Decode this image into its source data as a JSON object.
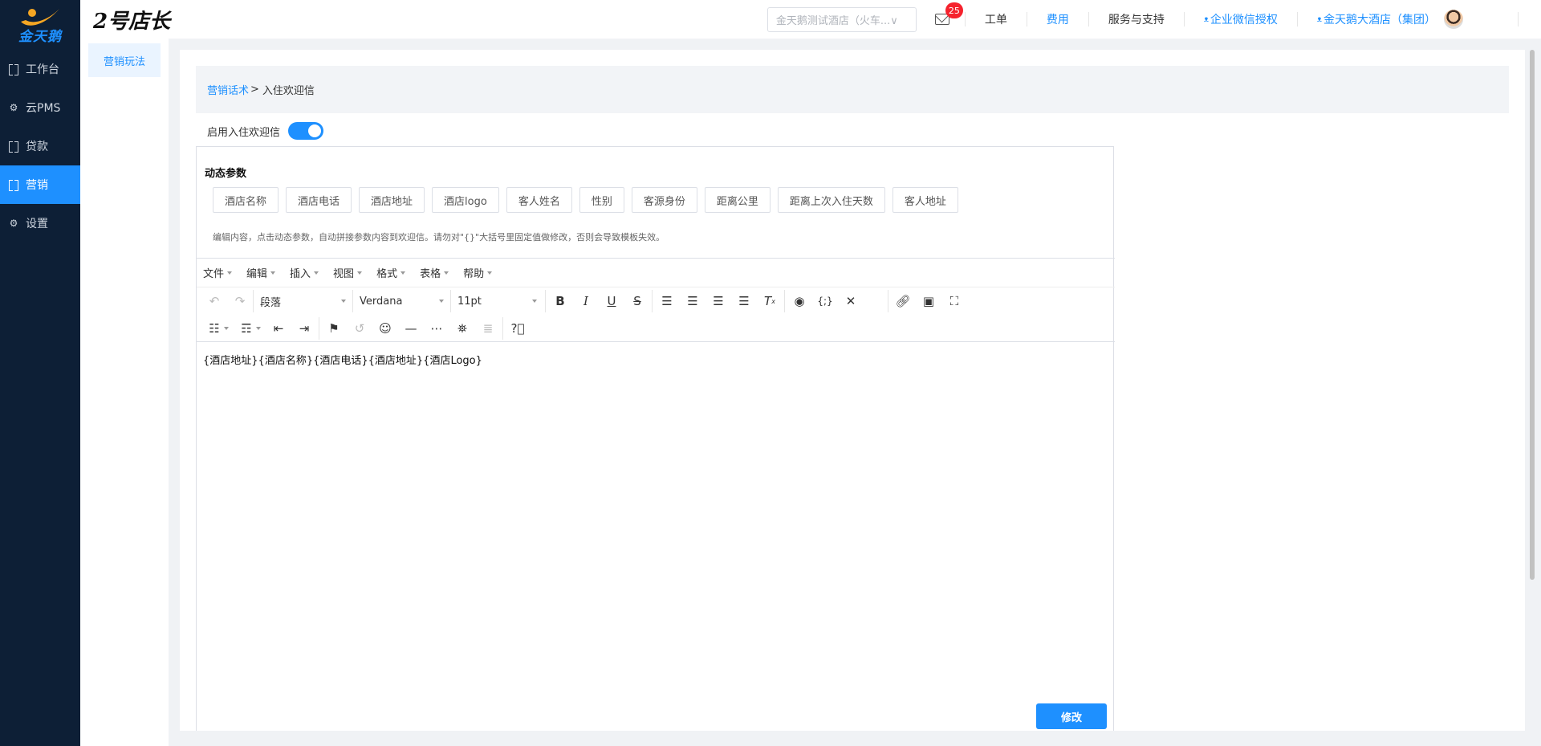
{
  "brand": {
    "logo_text": "金天鹅",
    "app_title": "2号店长"
  },
  "colors": {
    "sidebar_bg": "#0d1f36",
    "accent": "#1e90ff",
    "badge": "#f5222d"
  },
  "sidebar": {
    "items": [
      {
        "label": "工作台",
        "icon": "bracket-icon",
        "active": false
      },
      {
        "label": "云PMS",
        "icon": "gear-icon",
        "active": false
      },
      {
        "label": "贷款",
        "icon": "bracket-icon",
        "active": false
      },
      {
        "label": "营销",
        "icon": "bracket-icon",
        "active": true
      },
      {
        "label": "设置",
        "icon": "gear-icon",
        "active": false
      }
    ]
  },
  "header": {
    "store_select": "金天鹅测试酒店（火车...∨",
    "mail_badge": "25",
    "links": [
      "工单",
      "费用",
      "服务与支持",
      "企业微信授权",
      "金天鹅大酒店（集团）"
    ]
  },
  "submenu": {
    "item": "营销玩法"
  },
  "breadcrumb": {
    "link": "营销话术",
    "sep": ">",
    "current": "入住欢迎信"
  },
  "toggle": {
    "label": "启用入住欢迎信",
    "enabled": true
  },
  "params": {
    "title": "动态参数",
    "buttons": [
      "酒店名称",
      "酒店电话",
      "酒店地址",
      "酒店logo",
      "客人姓名",
      "性别",
      "客源身份",
      "距离公里",
      "距离上次入住天数",
      "客人地址"
    ],
    "hint": "编辑内容，点击动态参数，自动拼接参数内容到欢迎信。请勿对\"{}\"大括号里固定值做修改，否则会导致模板失效。"
  },
  "editor": {
    "menus": [
      "文件",
      "编辑",
      "插入",
      "视图",
      "格式",
      "表格",
      "帮助"
    ],
    "block_format": "段落",
    "font_family": "Verdana",
    "font_size": "11pt",
    "content": "{酒店地址}{酒店名称}{酒店电话}{酒店地址}{酒店Logo}"
  },
  "submit_label": "修改"
}
